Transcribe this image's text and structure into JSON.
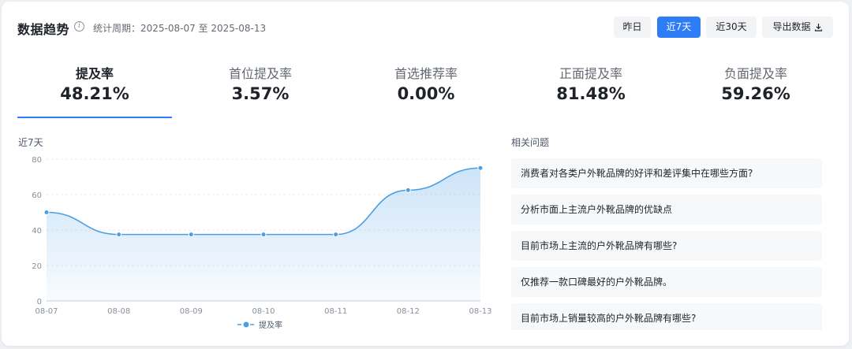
{
  "header": {
    "title": "数据趋势",
    "info_icon": "info-icon",
    "period_label": "统计周期：2025-08-07 至 2025-08-13",
    "buttons": {
      "yesterday": "昨日",
      "last7": "近7天",
      "last30": "近30天",
      "export": "导出数据"
    },
    "export_icon": "download-icon",
    "accent_color": "#2e7cf6"
  },
  "metrics": [
    {
      "label": "提及率",
      "value": "48.21%"
    },
    {
      "label": "首位提及率",
      "value": "3.57%"
    },
    {
      "label": "首选推荐率",
      "value": "0.00%"
    },
    {
      "label": "正面提及率",
      "value": "81.48%"
    },
    {
      "label": "负面提及率",
      "value": "59.26%"
    }
  ],
  "chart": {
    "title": "近7天"
  },
  "chart_data": {
    "type": "area",
    "x": [
      "08-07",
      "08-08",
      "08-09",
      "08-10",
      "08-11",
      "08-12",
      "08-13"
    ],
    "series": [
      {
        "name": "提及率",
        "values": [
          50,
          37.5,
          37.5,
          37.5,
          37.5,
          62.5,
          75
        ],
        "color": "#4a9fe4"
      }
    ],
    "ylim": [
      0,
      80
    ],
    "yticks": [
      0,
      20,
      40,
      60,
      80
    ],
    "grid": true,
    "legend": "bottom-center"
  },
  "related": {
    "title": "相关问题",
    "questions": [
      "消费者对各类户外靴品牌的好评和差评集中在哪些方面?",
      "分析市面上主流户外靴品牌的优缺点",
      "目前市场上主流的户外靴品牌有哪些?",
      "仅推荐一款口碑最好的户外靴品牌。",
      "目前市场上销量较高的户外靴品牌有哪些?"
    ]
  }
}
